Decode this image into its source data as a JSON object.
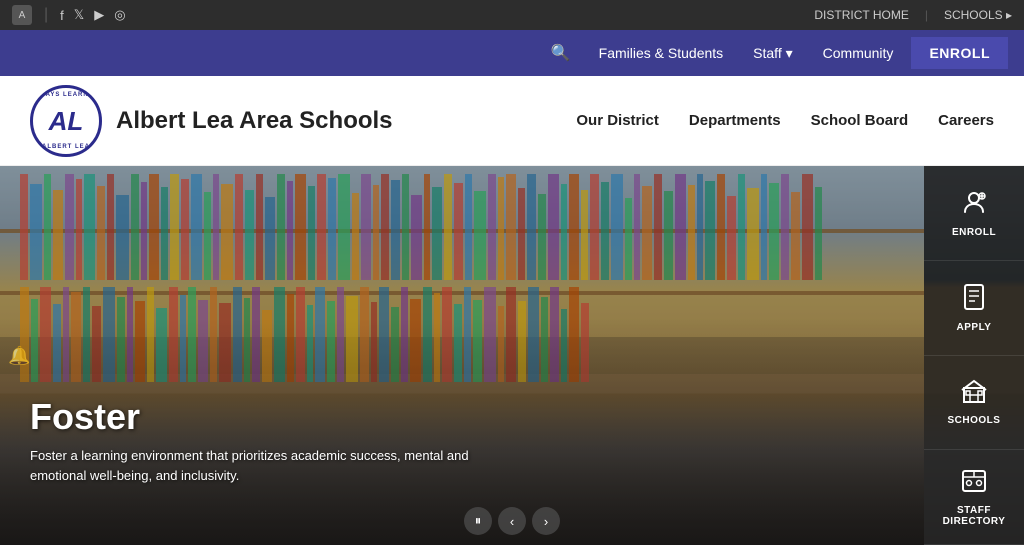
{
  "utility": {
    "left": {
      "translate_label": "Translate"
    },
    "right": {
      "district_home": "DISTRICT HOME",
      "schools": "SCHOOLS ▸"
    },
    "social": [
      "f",
      "𝕏",
      "▶",
      "⊙"
    ]
  },
  "navbar": {
    "links": [
      {
        "label": "Families & Students"
      },
      {
        "label": "Staff ▾"
      },
      {
        "label": "Community"
      }
    ],
    "enroll": "ENROLL"
  },
  "header": {
    "school_name": "Albert Lea Area Schools",
    "logo_top": "ALWAYS LEARNING",
    "logo_bottom": "ALBERT LEA",
    "logo_letters": "AL",
    "nav_items": [
      {
        "label": "Our District"
      },
      {
        "label": "Departments"
      },
      {
        "label": "School Board"
      },
      {
        "label": "Careers"
      }
    ]
  },
  "hero": {
    "title": "Foster",
    "subtitle": "Foster a learning environment that prioritizes academic success, mental and emotional well-being, and inclusivity."
  },
  "quick_links": [
    {
      "label": "ENROLL",
      "icon": "👤"
    },
    {
      "label": "APPLY",
      "icon": "📄"
    },
    {
      "label": "SCHOOLS",
      "icon": "🏫"
    },
    {
      "label": "STAFF DIRECTORY",
      "icon": "🏢"
    }
  ],
  "controls": {
    "pause_label": "⏸",
    "prev_label": "‹",
    "next_label": "›"
  }
}
